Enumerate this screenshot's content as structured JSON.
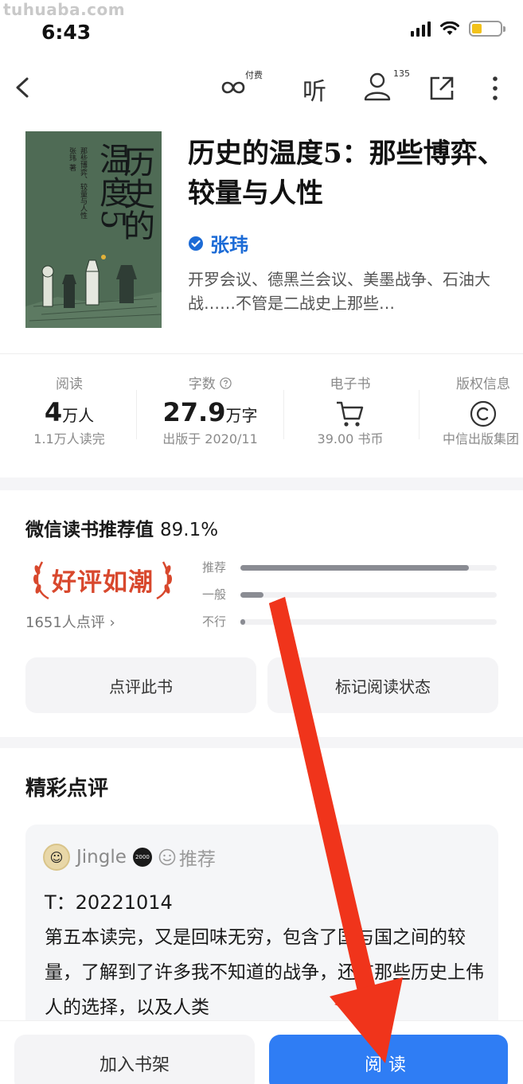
{
  "watermark": "tuhuaba.com",
  "status_bar": {
    "time": "6:43",
    "battery_color": "#f2c21b"
  },
  "nav": {
    "paid_label": "付费",
    "listen_label": "听",
    "follower_count": "135"
  },
  "cover": {
    "title_line1": "历史的",
    "title_line2": "温度5",
    "small_text": "那些博弈、较量与人性",
    "author_small": "张玮 著"
  },
  "book": {
    "title": "历史的温度5：那些博弈、较量与人性",
    "author": "张玮",
    "description": "开罗会议、德黑兰会议、美墨战争、石油大战……不管是二战史上那些…"
  },
  "stats": [
    {
      "label": "阅读",
      "value": "4",
      "unit": "万人",
      "sub": "1.1万人读完"
    },
    {
      "label": "字数",
      "value": "27.9",
      "unit": "万字",
      "sub": "出版于 2020/11"
    },
    {
      "label": "电子书",
      "value": "",
      "unit": "",
      "sub": "39.00 书币"
    },
    {
      "label": "版权信息",
      "value": "",
      "unit": "",
      "sub": "中信出版集团"
    }
  ],
  "recommend": {
    "title": "微信读书推荐值",
    "percent": "89.1%",
    "badge": "好评如潮",
    "review_count": "1651人点评",
    "bars": [
      {
        "label": "推荐",
        "fraction": 0.89
      },
      {
        "label": "一般",
        "fraction": 0.09
      },
      {
        "label": "不行",
        "fraction": 0.02
      }
    ],
    "review_button": "点评此书",
    "mark_button": "标记阅读状态"
  },
  "reviews": {
    "section_title": "精彩点评",
    "items": [
      {
        "user": "Jingle",
        "level": "2000",
        "tag": "推荐",
        "date_line": "T：20221014",
        "text": "第五本读完，又是回味无穷，包含了国与国之间的较量，了解到了许多我不知道的战争，还有那些历史上伟人的选择，以及人类"
      }
    ]
  },
  "bottom": {
    "shelf_label": "加入书架",
    "read_label": "阅读",
    "read_color": "#2f7df4"
  },
  "annotation": {
    "arrow_color": "#f0341b"
  }
}
